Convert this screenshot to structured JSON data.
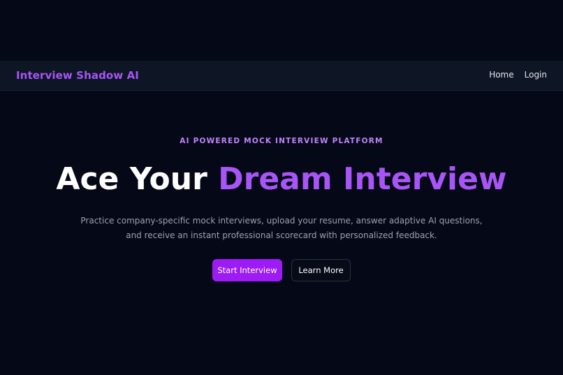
{
  "navbar": {
    "brand": "Interview Shadow AI",
    "links": [
      "Home",
      "Login"
    ]
  },
  "hero": {
    "eyebrow": "AI POWERED MOCK INTERVIEW PLATFORM",
    "headline_plain": "Ace Your ",
    "headline_accent": "Dream Interview",
    "subtitle_line1": "Practice company-specific mock interviews, upload your resume, answer adaptive AI questions,",
    "subtitle_line2": "and receive an instant professional scorecard with personalized feedback.",
    "primary_button": "Start Interview",
    "secondary_button": "Learn More"
  },
  "colors": {
    "background": "#050816",
    "navbar": "#0e1525",
    "accent": "#a855f7",
    "primary_button": "#9d1cf6"
  }
}
